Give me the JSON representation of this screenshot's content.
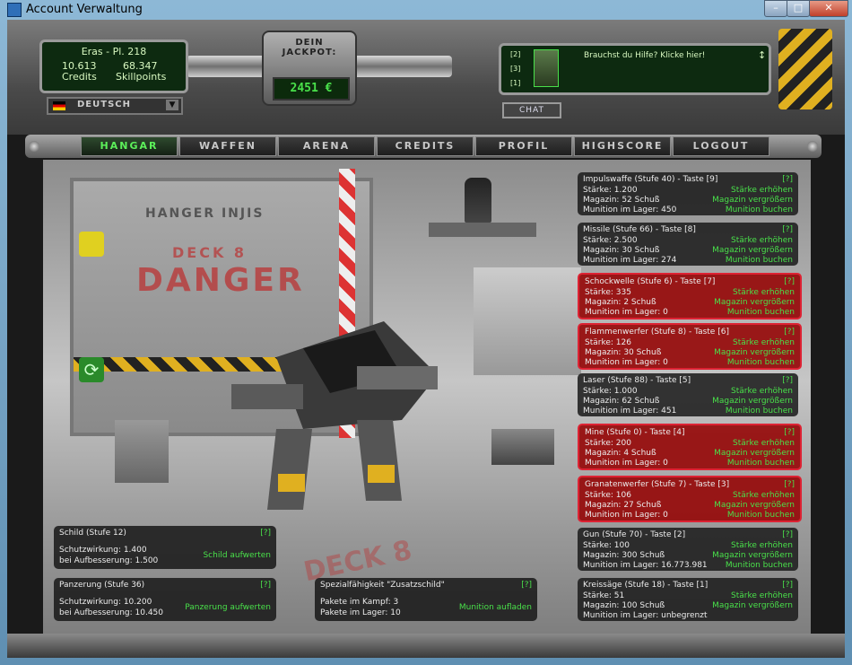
{
  "window": {
    "title": "Account Verwaltung",
    "min": "–",
    "max": "□",
    "close": "✕"
  },
  "player": {
    "name_level": "Eras - Pl. 218",
    "credits_value": "10.613",
    "credits_label": "Credits",
    "skill_value": "68.347",
    "skill_label": "Skillpoints"
  },
  "language": {
    "label": "DEUTSCH",
    "arrow": "▼"
  },
  "jackpot": {
    "label_line1": "DEIN",
    "label_line2": "JACKPOT:",
    "value": "2451 €"
  },
  "chat": {
    "help_text": "Brauchst du Hilfe? Klicke hier!",
    "line_tags": [
      "[2]",
      "[3]",
      "[1]"
    ],
    "chat_button": "CHAT"
  },
  "nav": [
    "HANGAR",
    "WAFFEN",
    "ARENA",
    "CREDITS",
    "PROFIL",
    "HIGHSCORE",
    "LOGOUT"
  ],
  "scene_text": {
    "hangar": "HANGER INJIS",
    "deck": "DECK 8",
    "danger": "DANGER",
    "floor": "DECK 8"
  },
  "weapons": [
    {
      "title": "Impulswaffe (Stufe 40) - Taste [9]",
      "help": "[?]",
      "l1": "Stärke: 1.200",
      "l2": "Magazin: 52 Schuß",
      "l3": "Munition im Lager: 450",
      "a1": "Stärke erhöhen",
      "a2": "Magazin vergrößern",
      "a3": "Munition buchen",
      "red": false
    },
    {
      "title": "Missile (Stufe 66) - Taste [8]",
      "help": "[?]",
      "l1": "Stärke: 2.500",
      "l2": "Magazin: 30 Schuß",
      "l3": "Munition im Lager: 274",
      "a1": "Stärke erhöhen",
      "a2": "Magazin vergrößern",
      "a3": "Munition buchen",
      "red": false
    },
    {
      "title": "Schockwelle (Stufe 6) - Taste [7]",
      "help": "[?]",
      "l1": "Stärke: 335",
      "l2": "Magazin: 2 Schuß",
      "l3": "Munition im Lager: 0",
      "a1": "Stärke erhöhen",
      "a2": "Magazin vergrößern",
      "a3": "Munition buchen",
      "red": true
    },
    {
      "title": "Flammenwerfer (Stufe 8) - Taste [6]",
      "help": "[?]",
      "l1": "Stärke: 126",
      "l2": "Magazin: 30 Schuß",
      "l3": "Munition im Lager: 0",
      "a1": "Stärke erhöhen",
      "a2": "Magazin vergrößern",
      "a3": "Munition buchen",
      "red": true
    },
    {
      "title": "Laser (Stufe 88) - Taste [5]",
      "help": "[?]",
      "l1": "Stärke: 1.000",
      "l2": "Magazin: 62 Schuß",
      "l3": "Munition im Lager: 451",
      "a1": "Stärke erhöhen",
      "a2": "Magazin vergrößern",
      "a3": "Munition buchen",
      "red": false
    },
    {
      "title": "Mine (Stufe 0) - Taste [4]",
      "help": "[?]",
      "l1": "Stärke: 200",
      "l2": "Magazin: 4 Schuß",
      "l3": "Munition im Lager: 0",
      "a1": "Stärke erhöhen",
      "a2": "Magazin vergrößern",
      "a3": "Munition buchen",
      "red": true
    },
    {
      "title": "Granatenwerfer (Stufe 7) - Taste [3]",
      "help": "[?]",
      "l1": "Stärke: 106",
      "l2": "Magazin: 27 Schuß",
      "l3": "Munition im Lager: 0",
      "a1": "Stärke erhöhen",
      "a2": "Magazin vergrößern",
      "a3": "Munition buchen",
      "red": true
    },
    {
      "title": "Gun (Stufe 70) - Taste [2]",
      "help": "[?]",
      "l1": "Stärke: 100",
      "l2": "Magazin: 300 Schuß",
      "l3": "Munition im Lager: 16.773.981",
      "a1": "Stärke erhöhen",
      "a2": "Magazin vergrößern",
      "a3": "Munition buchen",
      "red": false
    },
    {
      "title": "Kreissäge (Stufe 18) - Taste [1]",
      "help": "[?]",
      "l1": "Stärke: 51",
      "l2": "Magazin: 100 Schuß",
      "l3": "Munition im Lager: unbegrenzt",
      "a1": "Stärke erhöhen",
      "a2": "Magazin vergrößern",
      "a3": "",
      "red": false
    }
  ],
  "shield": {
    "title": "Schild (Stufe 12)",
    "help": "[?]",
    "l1": "Schutzwirkung: 1.400",
    "l2": "bei Aufbesserung: 1.500",
    "action": "Schild aufwerten"
  },
  "armor": {
    "title": "Panzerung (Stufe 36)",
    "help": "[?]",
    "l1": "Schutzwirkung: 10.200",
    "l2": "bei Aufbesserung: 10.450",
    "action": "Panzerung aufwerten"
  },
  "special": {
    "title": "Spezialfähigkeit \"Zusatzschild\"",
    "help": "[?]",
    "l1": "Pakete im Kampf: 3",
    "l2": "Pakete im Lager: 10",
    "action": "Munition aufladen"
  }
}
